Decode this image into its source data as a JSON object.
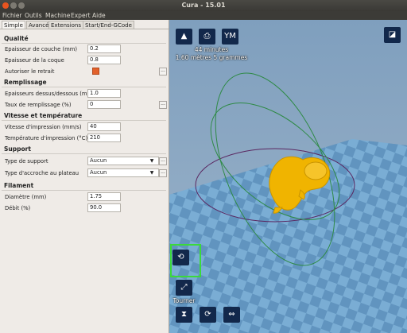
{
  "window": {
    "title": "Cura - 15.01"
  },
  "menu": [
    "Fichier",
    "Outils",
    "Machine",
    "Expert",
    "Aide"
  ],
  "tabs": [
    "Simple",
    "Avancé",
    "Extensions",
    "Start/End-GCode"
  ],
  "sections": {
    "quality": "Qualité",
    "fill": "Remplissage",
    "speed": "Vitesse et température",
    "support": "Support",
    "filament": "Filament"
  },
  "fields": {
    "layer_height": {
      "label": "Epaisseur de couche (mm)",
      "value": "0.2"
    },
    "shell": {
      "label": "Epaisseur de la coque",
      "value": "0.8"
    },
    "retraction": {
      "label": "Autoriser le retrait",
      "checked": true
    },
    "top_bottom": {
      "label": "Epaisseurs dessus/dessous (mm)",
      "value": "1.0"
    },
    "infill": {
      "label": "Taux de remplissage (%)",
      "value": "0"
    },
    "speed": {
      "label": "Vitesse d'impression (mm/s)",
      "value": "40"
    },
    "temp": {
      "label": "Température d'impression (°C)",
      "value": "210"
    },
    "support_type": {
      "label": "Type de support",
      "value": "Aucun"
    },
    "adhesion": {
      "label": "Type d'accroche au plateau",
      "value": "Aucun"
    },
    "diameter": {
      "label": "Diamètre (mm)",
      "value": "1.75"
    },
    "flow": {
      "label": "Débit (%)",
      "value": "90.0"
    }
  },
  "viewport": {
    "info_time": "44 minutes",
    "info_mat": "1.60 mètres 5 grammes",
    "ym_label": "YM",
    "rotate_label": "Tourner",
    "model_color": "#f0b400"
  },
  "colors": {
    "accent": "#e2612b",
    "toolbar": "#12284b",
    "highlight": "#3bd93b"
  }
}
